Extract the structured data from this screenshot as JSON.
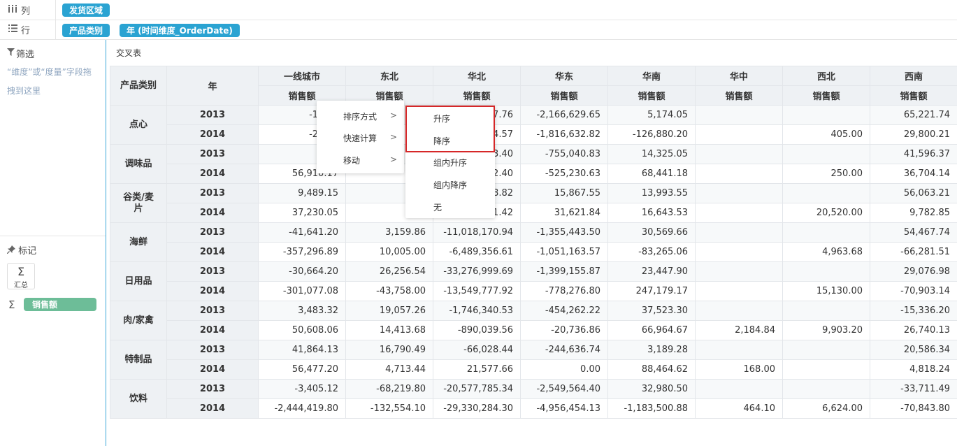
{
  "shelves": {
    "columns": {
      "label": "列",
      "icon": "column-bars-icon",
      "pills": [
        "发货区域"
      ]
    },
    "rows": {
      "label": "行",
      "icon": "list-rows-icon",
      "pills": [
        "产品类别",
        "年 (时间维度_OrderDate)"
      ]
    }
  },
  "filter": {
    "title": "筛选",
    "hint": "“维度”或“度量”字段拖拽到这里"
  },
  "marks": {
    "title": "标记",
    "sum_label": "汇总",
    "sum_symbol": "Σ",
    "measure_symbol": "Σ",
    "measure": "销售额"
  },
  "canvas": {
    "title": "交叉表"
  },
  "table": {
    "corner_category": "产品类别",
    "corner_year": "年",
    "regions": [
      "一线城市",
      "东北",
      "华北",
      "华东",
      "华南",
      "华中",
      "西北",
      "西南"
    ],
    "measure": "销售额",
    "groups": [
      {
        "category": "点心",
        "rows": [
          {
            "year": "2013",
            "values": [
              "-141,9",
              "",
              "7.76",
              "-2,166,629.65",
              "5,174.05",
              "",
              "",
              "65,221.74"
            ]
          },
          {
            "year": "2014",
            "values": [
              "-295,3",
              "",
              "4.57",
              "-1,816,632.82",
              "-126,880.20",
              "",
              "405.00",
              "29,800.21"
            ]
          }
        ]
      },
      {
        "category": "调味品",
        "rows": [
          {
            "year": "2013",
            "values": [
              "29,7",
              "",
              "3.40",
              "-755,040.83",
              "14,325.05",
              "",
              "",
              "41,596.37"
            ]
          },
          {
            "year": "2014",
            "values": [
              "56,910.17",
              "25,9",
              "2.40",
              "-525,230.63",
              "68,441.18",
              "",
              "250.00",
              "36,704.14"
            ]
          }
        ]
      },
      {
        "category": "谷类/麦片",
        "rows": [
          {
            "year": "2013",
            "values": [
              "9,489.15",
              "23,7",
              "8.82",
              "15,867.55",
              "13,993.55",
              "",
              "",
              "56,063.21"
            ]
          },
          {
            "year": "2014",
            "values": [
              "37,230.05",
              "16,1",
              "1.42",
              "31,621.84",
              "16,643.53",
              "",
              "20,520.00",
              "9,782.85"
            ]
          }
        ]
      },
      {
        "category": "海鲜",
        "rows": [
          {
            "year": "2013",
            "values": [
              "-41,641.20",
              "3,159.86",
              "-11,018,170.94",
              "-1,355,443.50",
              "30,569.66",
              "",
              "",
              "54,467.74"
            ]
          },
          {
            "year": "2014",
            "values": [
              "-357,296.89",
              "10,005.00",
              "-6,489,356.61",
              "-1,051,163.57",
              "-83,265.06",
              "",
              "4,963.68",
              "-66,281.51"
            ]
          }
        ]
      },
      {
        "category": "日用品",
        "rows": [
          {
            "year": "2013",
            "values": [
              "-30,664.20",
              "26,256.54",
              "-33,276,999.69",
              "-1,399,155.87",
              "23,447.90",
              "",
              "",
              "29,076.98"
            ]
          },
          {
            "year": "2014",
            "values": [
              "-301,077.08",
              "-43,758.00",
              "-13,549,777.92",
              "-778,276.80",
              "247,179.17",
              "",
              "15,130.00",
              "-70,903.14"
            ]
          }
        ]
      },
      {
        "category": "肉/家禽",
        "rows": [
          {
            "year": "2013",
            "values": [
              "3,483.32",
              "19,057.26",
              "-1,746,340.53",
              "-454,262.22",
              "37,523.30",
              "",
              "",
              "-15,336.20"
            ]
          },
          {
            "year": "2014",
            "values": [
              "50,608.06",
              "14,413.68",
              "-890,039.56",
              "-20,736.86",
              "66,964.67",
              "2,184.84",
              "9,903.20",
              "26,740.13"
            ]
          }
        ]
      },
      {
        "category": "特制品",
        "rows": [
          {
            "year": "2013",
            "values": [
              "41,864.13",
              "16,790.49",
              "-66,028.44",
              "-244,636.74",
              "3,189.28",
              "",
              "",
              "20,586.34"
            ]
          },
          {
            "year": "2014",
            "values": [
              "56,477.20",
              "4,713.44",
              "21,577.66",
              "0.00",
              "88,464.62",
              "168.00",
              "",
              "4,818.24"
            ]
          }
        ]
      },
      {
        "category": "饮料",
        "rows": [
          {
            "year": "2013",
            "values": [
              "-3,405.12",
              "-68,219.80",
              "-20,577,785.34",
              "-2,549,564.40",
              "32,980.50",
              "",
              "",
              "-33,711.49"
            ]
          },
          {
            "year": "2014",
            "values": [
              "-2,444,419.80",
              "-132,554.10",
              "-29,330,284.30",
              "-4,956,454.13",
              "-1,183,500.88",
              "464.10",
              "6,624.00",
              "-70,843.80"
            ]
          }
        ]
      }
    ]
  },
  "context_menu": {
    "items": [
      "排序方式",
      "快速计算",
      "移动"
    ],
    "arrow": ">"
  },
  "sort_submenu": {
    "items": [
      "升序",
      "降序",
      "组内升序",
      "组内降序",
      "无"
    ],
    "highlight_color": "#d62728"
  }
}
